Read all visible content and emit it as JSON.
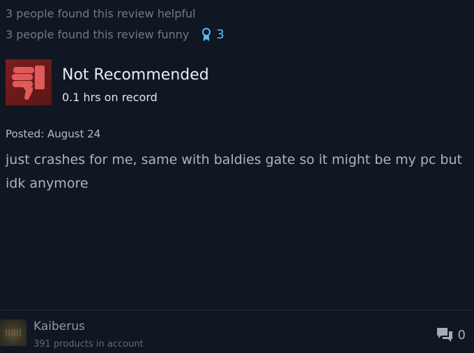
{
  "votes": {
    "helpful_text": "3 people found this review helpful",
    "funny_text": "3 people found this review funny",
    "award_count": "3"
  },
  "review": {
    "verdict": "Not Recommended",
    "hours": "0.1 hrs on record",
    "posted": "Posted: August 24",
    "body": "just crashes for me, same with baldies gate so it might be my pc but idk anymore"
  },
  "author": {
    "name": "Kaiberus",
    "products": "391 products in account",
    "comment_count": "0"
  },
  "icons": {
    "award": "award-ribbon-icon",
    "verdict": "thumbs-down-icon",
    "comments": "comment-bubbles-icon"
  },
  "colors": {
    "background": "#111722",
    "award": "#59bff8",
    "verdict_box": "#7b1e1e",
    "thumb": "#e05a5a"
  }
}
